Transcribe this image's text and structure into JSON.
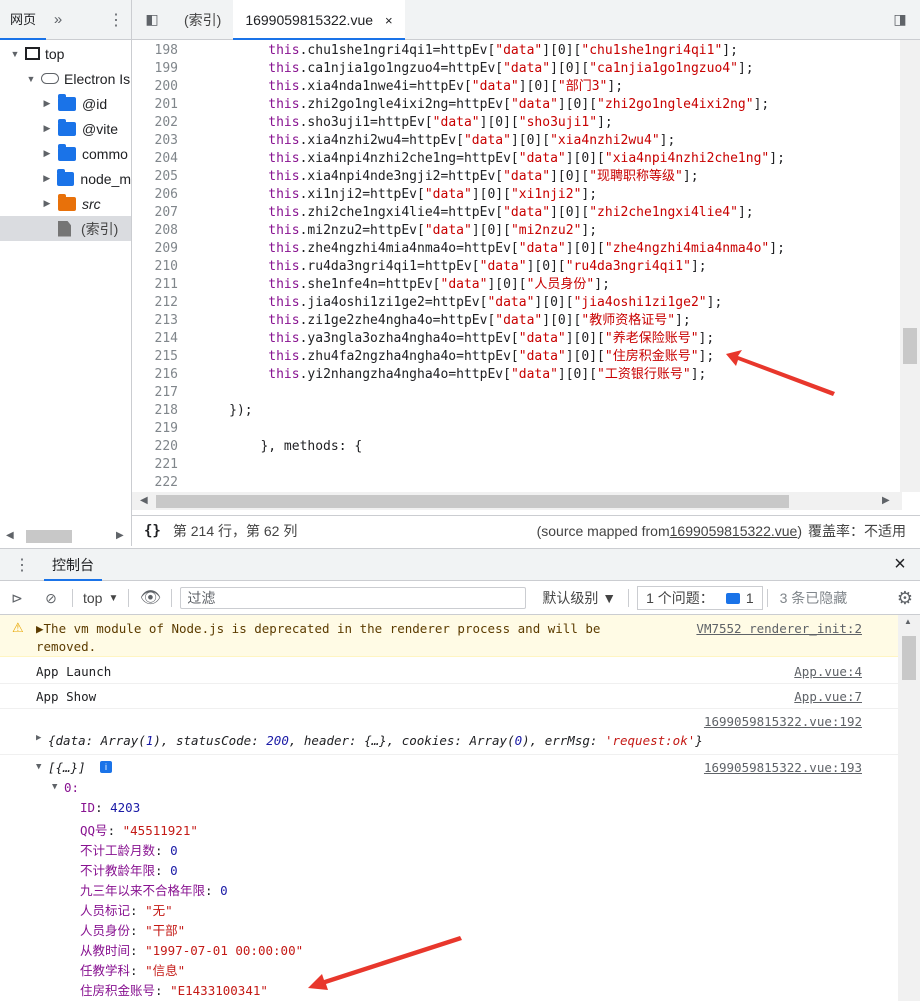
{
  "navigator": {
    "tabs": [
      "网页",
      "»"
    ],
    "tree": [
      {
        "label": "top",
        "icon": "frame-icon",
        "expanded": true
      },
      {
        "label": "Electron Is",
        "icon": "cloud-icon",
        "expanded": true
      },
      {
        "label": "@id",
        "icon": "folder-icon",
        "expanded": false
      },
      {
        "label": "@vite",
        "icon": "folder-icon",
        "expanded": false
      },
      {
        "label": "commo",
        "icon": "folder-icon",
        "expanded": false
      },
      {
        "label": "node_m",
        "icon": "folder-icon",
        "expanded": false
      },
      {
        "label": "src",
        "icon": "folder-orange-icon",
        "expanded": false
      },
      {
        "label": "(索引)",
        "icon": "file-icon",
        "expanded": false
      }
    ]
  },
  "editor": {
    "tabs": [
      {
        "label": "(索引)",
        "active": false
      },
      {
        "label": "1699059815322.vue",
        "active": true,
        "close": "×"
      }
    ],
    "lines": [
      {
        "n": "198",
        "s": "chu1she1ngri4qi1"
      },
      {
        "n": "199",
        "s": "ca1njia1go1ngzuo4"
      },
      {
        "n": "200",
        "s": "xia4nda1nwe4i",
        "v": "部门3"
      },
      {
        "n": "201",
        "s": "zhi2go1ngle4ixi2ng"
      },
      {
        "n": "202",
        "s": "sho3uji1"
      },
      {
        "n": "203",
        "s": "xia4nzhi2wu4"
      },
      {
        "n": "204",
        "s": "xia4npi4nzhi2che1ng"
      },
      {
        "n": "205",
        "s": "xia4npi4nde3ngji2",
        "v": "现聘职称等级"
      },
      {
        "n": "206",
        "s": "xi1nji2"
      },
      {
        "n": "207",
        "s": "zhi2che1ngxi4lie4"
      },
      {
        "n": "208",
        "s": "mi2nzu2"
      },
      {
        "n": "209",
        "s": "zhe4ngzhi4mia4nma4o"
      },
      {
        "n": "210",
        "s": "ru4da3ngri4qi1"
      },
      {
        "n": "211",
        "s": "she1nfe4n",
        "v": "人员身份"
      },
      {
        "n": "212",
        "s": "jia4oshi1zi1ge2"
      },
      {
        "n": "213",
        "s": "zi1ge2zhe4ngha4o",
        "v": "教师资格证号"
      },
      {
        "n": "214",
        "s": "ya3ngla3ozha4ngha4o",
        "v": "养老保险账号"
      },
      {
        "n": "215",
        "s": "zhu4fa2ngzha4ngha4o",
        "v": "住房积金账号"
      },
      {
        "n": "216",
        "s": "yi2nhangzha4ngha4o",
        "v": "工资银行账号"
      },
      {
        "n": "217",
        "raw": ""
      },
      {
        "n": "218",
        "raw": "});"
      },
      {
        "n": "219",
        "raw": ""
      },
      {
        "n": "220",
        "raw": "    }, methods: {"
      },
      {
        "n": "221",
        "raw": ""
      },
      {
        "n": "222",
        "raw": ""
      }
    ],
    "line_prefix_kw": "this",
    "assign": "=httpEv[",
    "data_key": "\"data\"",
    "index": "][0][",
    "tail": "];"
  },
  "status": {
    "braces": "{}",
    "position": "第 214 行，第 62 列",
    "source_mapped_prefix": "(source mapped from ",
    "source_mapped_file": "1699059815322.vue",
    "source_mapped_suffix": ")",
    "coverage": "覆盖率：不适用"
  },
  "drawer": {
    "tab": "控制台"
  },
  "toolbar": {
    "context": "top",
    "filter_placeholder": "过滤",
    "levels": "默认级别 ▼",
    "issues_label": "1 个问题：",
    "issues_count": "1",
    "hidden": "3 条已隐藏"
  },
  "console": {
    "warning_text_1": "▶The vm module of Node.js is deprecated in the renderer process and will be",
    "warning_text_2": "removed.",
    "warning_src": "VM7552 renderer_init:2",
    "log1": "App Launch",
    "log1_src": "App.vue:4",
    "log2": "App Show",
    "log2_src": "App.vue:7",
    "obj_src": "1699059815322.vue:192",
    "obj_line": "{data: Array(1), statusCode: 200, header: {…}, cookies: Array(0), errMsg: 'request:ok'}",
    "arr_src": "1699059815322.vue:193",
    "arr_head": "[{…}]",
    "arr_index": "0:",
    "fields": [
      {
        "k": "ID",
        "v": "4203",
        "type": "num"
      },
      {
        "k": "QQ号",
        "v": "\"45511921\"",
        "type": "str"
      },
      {
        "k": "不计工龄月数",
        "v": "0",
        "type": "num"
      },
      {
        "k": "不计教龄年限",
        "v": "0",
        "type": "num"
      },
      {
        "k": "九三年以来不合格年限",
        "v": "0",
        "type": "num"
      },
      {
        "k": "人员标记",
        "v": "\"无\"",
        "type": "str"
      },
      {
        "k": "人员身份",
        "v": "\"干部\"",
        "type": "str"
      },
      {
        "k": "从教时间",
        "v": "\"1997-07-01 00:00:00\"",
        "type": "str"
      },
      {
        "k": "任教学科",
        "v": "\"信息\"",
        "type": "str"
      },
      {
        "k": "住房积金账号",
        "v": "\"E1433100341\"",
        "type": "str"
      }
    ]
  },
  "colors": {
    "accent": "#1a73e8",
    "arrow": "#e8372c"
  }
}
